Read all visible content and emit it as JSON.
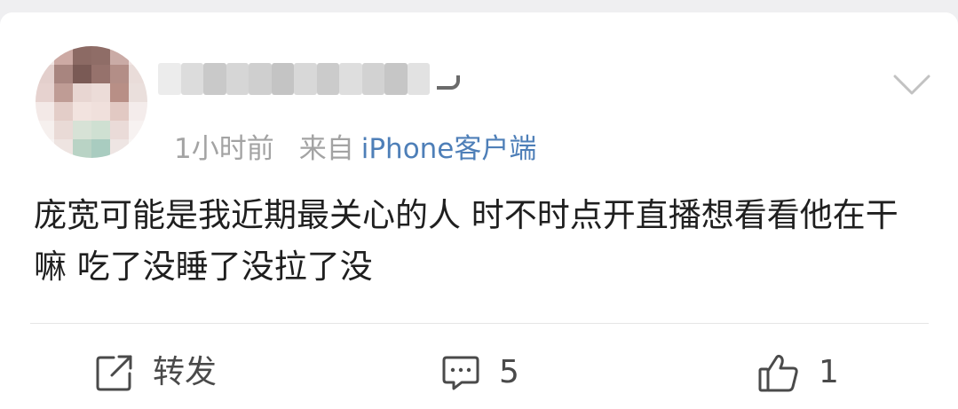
{
  "post": {
    "time": "1小时前",
    "source_prefix": "来自",
    "source_app": "iPhone客户端",
    "content": "庞宽可能是我近期最关心的人 时不时点开直播想看看他在干嘛 吃了没睡了没拉了没"
  },
  "actions": {
    "repost_label": "转发",
    "comment_count": "5",
    "like_count": "1"
  },
  "icons": {
    "more": "chevron-down-icon",
    "repost": "share-square-icon",
    "comment": "comment-bubble-icon",
    "like": "thumbs-up-icon"
  },
  "colors": {
    "source_link": "#4e7fb8",
    "meta_text": "#a3a3a3",
    "body_text": "#1f1f1f",
    "action_text": "#4a4a4a",
    "page_bg": "#efeff1",
    "card_bg": "#ffffff"
  }
}
